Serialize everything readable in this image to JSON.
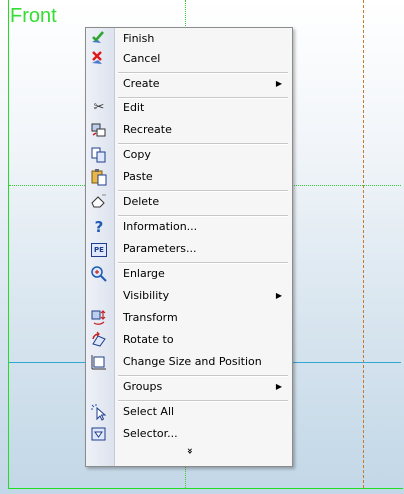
{
  "view": {
    "title": "Front"
  },
  "menu": {
    "items": [
      {
        "label": "Finish",
        "icon": "finish-check-icon"
      },
      {
        "label": "Cancel",
        "icon": "cancel-x-icon"
      },
      {
        "label": "Create",
        "submenu": true
      },
      {
        "label": "Edit",
        "icon": "scissors-icon"
      },
      {
        "label": "Recreate",
        "icon": "recreate-cube-icon"
      },
      {
        "label": "Copy",
        "icon": "copy-icon"
      },
      {
        "label": "Paste",
        "icon": "paste-icon"
      },
      {
        "label": "Delete",
        "icon": "delete-eraser-icon"
      },
      {
        "label": "Information...",
        "icon": "help-question-icon"
      },
      {
        "label": "Parameters...",
        "icon": "parameters-icon"
      },
      {
        "label": "Enlarge",
        "icon": "zoom-icon"
      },
      {
        "label": "Visibility",
        "submenu": true
      },
      {
        "label": "Transform",
        "icon": "transform-icon"
      },
      {
        "label": "Rotate to",
        "icon": "rotate-icon"
      },
      {
        "label": "Change Size and Position",
        "icon": "resize-icon"
      },
      {
        "label": "Groups",
        "submenu": true
      },
      {
        "label": "Select All",
        "icon": "select-all-cursor-icon"
      },
      {
        "label": "Selector...",
        "icon": "selector-filter-icon"
      }
    ],
    "submenu_arrow": "▶",
    "more_glyph": "»"
  },
  "colors": {
    "view_border": "#22dd22",
    "guide_orange": "#c87a2a",
    "guide_cyan": "#33a6d6"
  }
}
